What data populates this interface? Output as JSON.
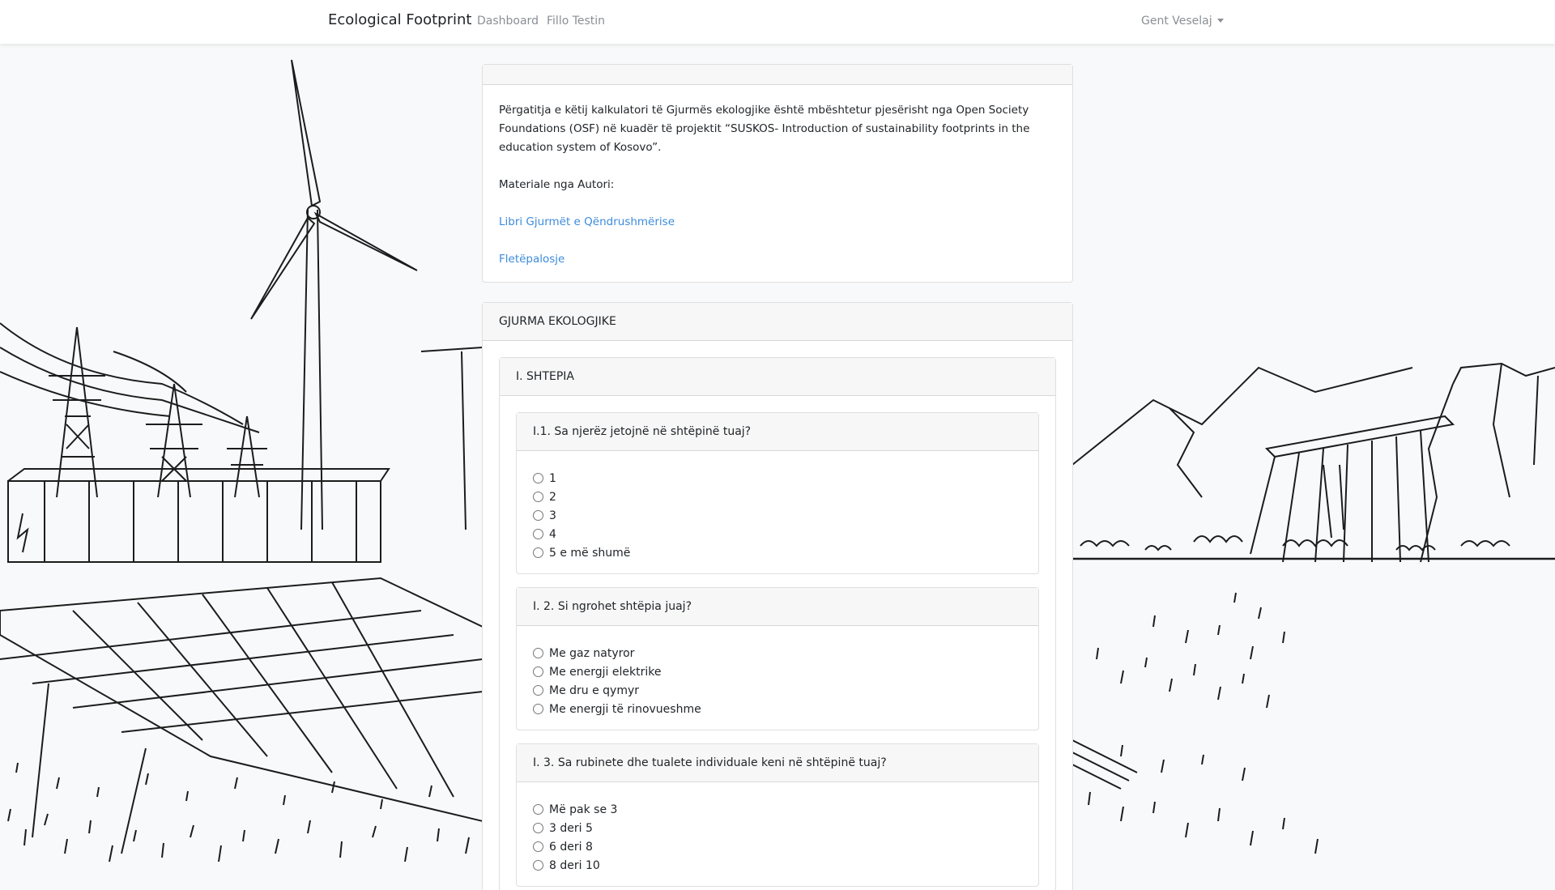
{
  "navbar": {
    "brand": "Ecological Footprint",
    "links": [
      "Dashboard",
      "Fillo Testin"
    ],
    "user": "Gent Veselaj"
  },
  "info": {
    "paragraph": "Përgatitja e këtij kalkulatori të Gjurmës ekologjike është mbështetur pjesërisht nga Open Society Foundations (OSF) në kuadër të projektit “SUSKOS- Introduction of sustainability footprints in the education system of Kosovo”.",
    "materials_label": "Materiale nga Autori:",
    "link_book": "Libri Gjurmët e Qëndrushmërise",
    "link_leaflet": "Fletëpalosje"
  },
  "quiz": {
    "title": "GJURMA EKOLOGJIKE",
    "section_title": "I. SHTEPIA",
    "questions": [
      {
        "title": "I.1. Sa njerëz jetojnë në shtëpinë tuaj?",
        "options": [
          "1",
          "2",
          "3",
          "4",
          "5 e më shumë"
        ]
      },
      {
        "title": "I. 2. Si ngrohet shtëpia juaj?",
        "options": [
          "Me gaz natyror",
          "Me energji elektrike",
          "Me dru e qymyr",
          "Me energji të rinovueshme"
        ]
      },
      {
        "title": "I. 3. Sa rubinete dhe tualete individuale keni në shtëpinë tuaj?",
        "options": [
          "Më pak se 3",
          "3 deri 5",
          "6 deri 8",
          "8 deri 10"
        ]
      }
    ]
  },
  "icons": {
    "user_menu": "chevron-down-icon",
    "radio": "radio-unchecked-icon"
  },
  "colors": {
    "link": "#3d8bdb",
    "page_bg": "#f8f9fa",
    "card_header_bg": "#f7f7f7"
  }
}
